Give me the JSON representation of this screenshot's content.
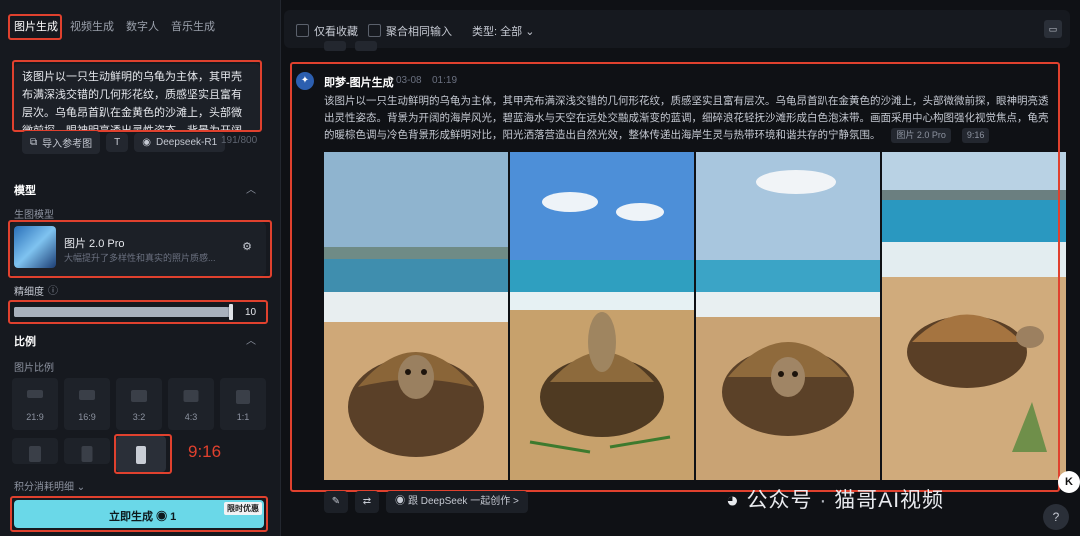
{
  "tabs": [
    "图片生成",
    "视频生成",
    "数字人",
    "音乐生成"
  ],
  "prompt_text": "该图片以一只生动鲜明的乌龟为主体，其甲壳布满深浅交错的几何形花纹，质感坚实且富有层次。乌龟昂首趴在金黄色的沙滩上，头部微微前探，眼神明亮透出灵性姿态。背景为开阔的海岸风光",
  "chips": {
    "import_ref": "导入参考图",
    "text_icon": "T",
    "deepseek": "Deepseek-R1",
    "count": "191/800"
  },
  "model_section": {
    "title": "模型",
    "sub": "生图模型",
    "name": "图片 2.0 Pro",
    "desc": "大幅提升了多样性和真实的照片质感..."
  },
  "precision": {
    "label": "精细度",
    "value": "10",
    "level": 0.98
  },
  "ratio_section": {
    "title": "比例",
    "sub": "图片比例",
    "options": [
      "21:9",
      "16:9",
      "3:2",
      "4:3",
      "1:1"
    ],
    "selected_big_label": "9:16"
  },
  "credits_label": "积分消耗明细",
  "generate": {
    "label": "立即生成",
    "cost": "1",
    "badge": "限时优惠"
  },
  "toolbar": {
    "fav": "仅看收藏",
    "merge": "聚合相同输入",
    "type": "类型: 全部"
  },
  "post": {
    "title": "即梦-图片生成",
    "date": "03-08",
    "time": "01:19",
    "body": "该图片以一只生动鲜明的乌龟为主体，其甲壳布满深浅交错的几何形花纹，质感坚实且富有层次。乌龟昂首趴在金黄色的沙滩上，头部微微前探，眼神明亮透出灵性姿态。背景为开阔的海岸风光，碧蓝海水与天空在远处交融成渐变的蓝调，细碎浪花轻抚沙滩形成白色泡沫带。画面采用中心构图强化视觉焦点，龟壳的暖棕色调与冷色背景形成鲜明对比，阳光洒落营造出自然光效，整体传递出海岸生灵与热带环境和谐共存的宁静氛围。",
    "tag_model": "图片 2.0 Pro",
    "tag_ratio": "9:16"
  },
  "actions": {
    "deepseek": "跟 DeepSeek 一起创作 >"
  },
  "watermark": {
    "left": "公众号",
    "dot": "·",
    "right": "猫哥AI视频"
  },
  "float": {
    "k": "K",
    "help": "?"
  },
  "colors": {
    "accent": "#6ad8e8",
    "highlight": "#e0412e"
  }
}
